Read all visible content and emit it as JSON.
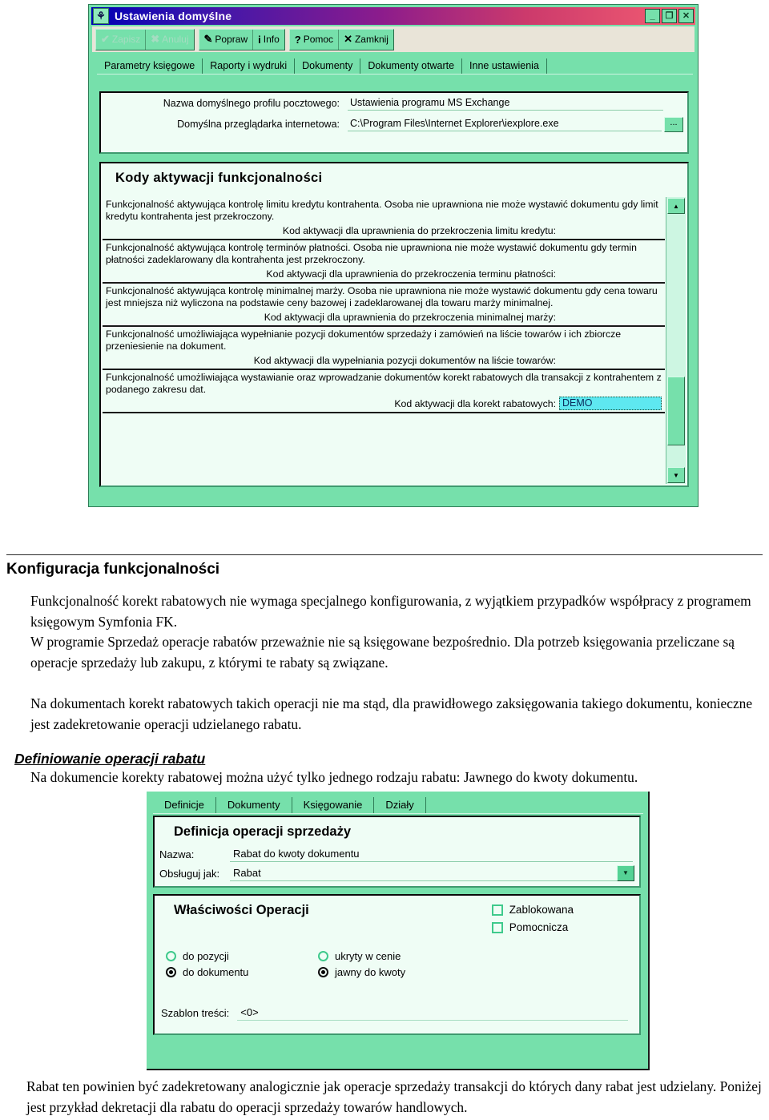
{
  "screenshot1": {
    "window_title": "Ustawienia domyślne",
    "app_icon": "app-icon",
    "window_buttons": [
      {
        "name": "minimize",
        "glyph": "_"
      },
      {
        "name": "maximize",
        "glyph": "❐"
      },
      {
        "name": "close",
        "glyph": "✕"
      }
    ],
    "toolbar": [
      {
        "label": "Zapisz",
        "icon": "✔",
        "disabled": true
      },
      {
        "label": "Anuluj",
        "icon": "✖",
        "disabled": true
      },
      {
        "label": "Popraw",
        "icon": "✎",
        "disabled": false
      },
      {
        "label": "Info",
        "icon": "i",
        "disabled": false
      },
      {
        "label": "Pomoc",
        "icon": "?",
        "disabled": false
      },
      {
        "label": "Zamknij",
        "icon": "✕",
        "disabled": false
      }
    ],
    "tabs": [
      "Parametry księgowe",
      "Raporty i wydruki",
      "Dokumenty",
      "Dokumenty otwarte",
      "Inne ustawienia"
    ],
    "fields": [
      {
        "label": "Nazwa domyślnego profilu pocztowego:",
        "value": "Ustawienia programu MS Exchange",
        "browse": ""
      },
      {
        "label": "Domyślna przeglądarka internetowa:",
        "value": "C:\\Program Files\\Internet Explorer\\iexplore.exe",
        "browse": "..."
      }
    ],
    "codes_panel": {
      "title": "Kody aktywacji funkcjonalności",
      "items": [
        {
          "description": "Funkcjonalność aktywująca kontrolę limitu kredytu kontrahenta. Osoba nie uprawniona nie może wystawić dokumentu gdy limit kredytu kontrahenta jest przekroczony.",
          "field_label": "Kod aktywacji dla uprawnienia do przekroczenia limitu kredytu:",
          "value": ""
        },
        {
          "description": "Funkcjonalność aktywująca kontrolę terminów płatności. Osoba nie uprawniona nie może wystawić dokumentu gdy termin płatności zadeklarowany dla kontrahenta jest przekroczony.",
          "field_label": "Kod aktywacji dla uprawnienia do przekroczenia terminu płatności:",
          "value": ""
        },
        {
          "description": "Funkcjonalność aktywująca kontrolę minimalnej marży. Osoba nie uprawniona nie może wystawić dokumentu gdy cena towaru jest mniejsza niż wyliczona na podstawie ceny bazowej i zadeklarowanej dla towaru marży minimalnej.",
          "field_label": "Kod aktywacji dla uprawnienia do przekroczenia minimalnej marży:",
          "value": ""
        },
        {
          "description": "Funkcjonalność umożliwiająca wypełnianie pozycji dokumentów sprzedaży i zamówień na liście towarów i ich zbiorcze przeniesienie na dokument.",
          "field_label": "Kod aktywacji dla wypełniania pozycji dokumentów na liście towarów:",
          "value": ""
        },
        {
          "description": "Funkcjonalność umożliwiająca wystawianie oraz wprowadzanie dokumentów korekt rabatowych dla transakcji z kontrahentem z podanego zakresu dat.",
          "field_label": "Kod aktywacji dla korekt rabatowych:",
          "value": "DEMO"
        }
      ],
      "scrollbar": {
        "up_glyph": "▲",
        "down_glyph": "▼"
      }
    }
  },
  "document": {
    "section_title": "Konfiguracja funkcjonalności",
    "paragraph1": "Funkcjonalność korekt rabatowych nie wymaga specjalnego konfigurowania, z wyjątkiem przypadków współpracy z programem księgowym Symfonia FK.",
    "paragraph2": "W programie Sprzedaż operacje rabatów przeważnie nie są księgowane bezpośrednio. Dla potrzeb księgowania przeliczane są operacje sprzedaży lub zakupu, z którymi te rabaty są związane.",
    "paragraph3": "Na dokumentach korekt rabatowych takich operacji nie ma stąd, dla prawidłowego zaksięgowania takiego dokumentu, konieczne jest zadekretowanie operacji udzielanego rabatu.",
    "subsection_title": "Definiowanie operacji rabatu",
    "paragraph4": "Na dokumencie korekty rabatowej można użyć tylko jednego rodzaju rabatu: Jawnego do kwoty dokumentu.",
    "paragraph5": "Rabat ten powinien być zadekretowany analogicznie jak operacje sprzedaży transakcji do których dany rabat jest udzielany. Poniżej jest przykład dekretacji dla rabatu do operacji sprzedaży towarów handlowych."
  },
  "screenshot2": {
    "tabs": [
      {
        "pre": "D",
        "accel": "",
        "label": "Definicje",
        "underline_index": 0
      },
      {
        "label": "Dokumenty",
        "underline_index": 4
      },
      {
        "label": "Księgowanie",
        "underline_index": 0
      },
      {
        "label": "Działy",
        "underline_index": 0
      }
    ],
    "tab_labels": [
      "Definicje",
      "Dokumenty",
      "Księgowanie",
      "Działy"
    ],
    "definition_panel": {
      "title": "Definicja operacji sprzedaży",
      "name_label": "Nazwa:",
      "name_value": "Rabat do kwoty dokumentu",
      "handle_label": "Obsługuj jak:",
      "handle_value": "Rabat",
      "handle_arrow": "▼"
    },
    "properties_panel": {
      "title": "Właściwości Operacji",
      "checkboxes": [
        {
          "label": "Zablokowana",
          "checked": false
        },
        {
          "label": "Pomocnicza",
          "checked": false
        }
      ],
      "radios_left": [
        {
          "label": "do pozycji",
          "selected": false
        },
        {
          "label": "do dokumentu",
          "selected": true
        }
      ],
      "radios_right": [
        {
          "label": "ukryty w cenie",
          "selected": false
        },
        {
          "label": "jawny do kwoty",
          "selected": true
        }
      ],
      "template_label": "Szablon treści:",
      "template_value": "<0>"
    }
  },
  "colors": {
    "window_green": "#76e0ab",
    "panel_bg": "#effdf5",
    "title_gradient_start": "#0000b4",
    "title_gradient_end": "#f55f72",
    "focus_field": "#5ee8f0"
  }
}
